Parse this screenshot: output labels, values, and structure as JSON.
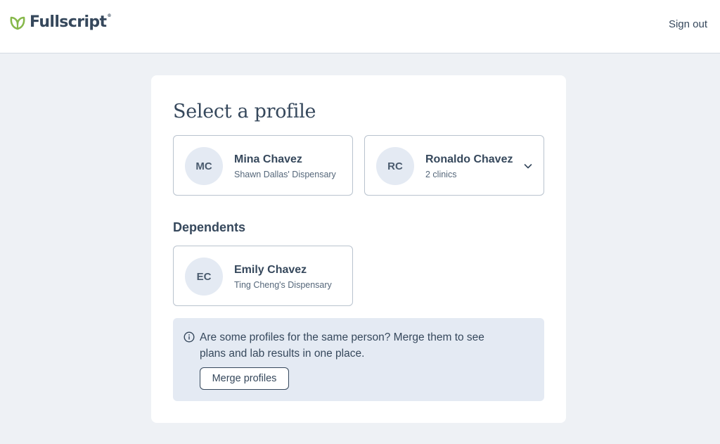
{
  "header": {
    "logo_text": "Fullscript",
    "logo_mark": "®",
    "signout_label": "Sign out"
  },
  "page": {
    "title": "Select a profile",
    "profiles": [
      {
        "initials": "MC",
        "name": "Mina Chavez",
        "sub": "Shawn Dallas' Dispensary"
      },
      {
        "initials": "RC",
        "name": "Ronaldo Chavez",
        "sub": "2 clinics",
        "icon": "chevron-down-icon"
      }
    ],
    "dependents_heading": "Dependents",
    "dependents": [
      {
        "initials": "EC",
        "name": "Emily Chavez",
        "sub": "Ting Cheng's Dispensary"
      }
    ],
    "merge": {
      "icon": "info-icon",
      "text": "Are some profiles for the same person? Merge them to see plans and lab results in one place.",
      "button_label": "Merge profiles"
    }
  },
  "colors": {
    "brand_green": "#86b84a",
    "text": "#36485c",
    "background": "#eef1f5",
    "avatar_bg": "#e4eaf3",
    "info_bg": "#e4eaf3"
  }
}
